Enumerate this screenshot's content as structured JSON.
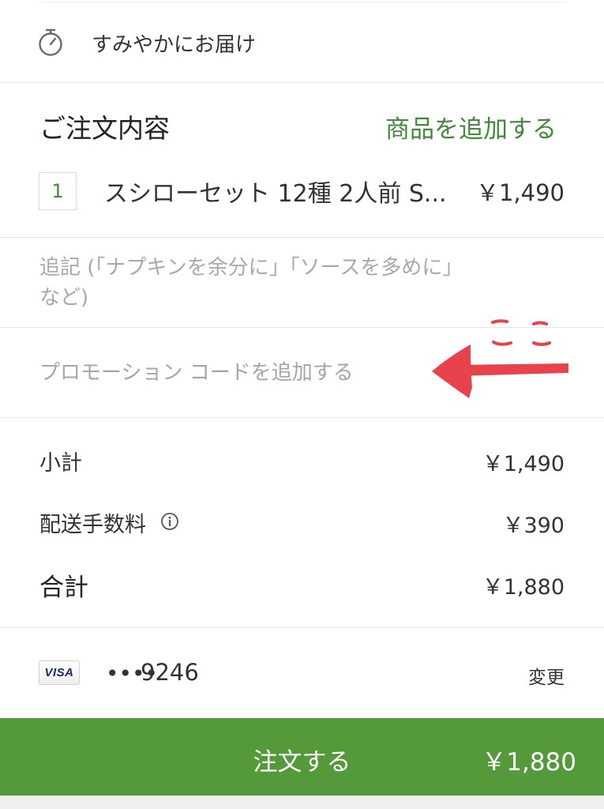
{
  "delivery": {
    "icon": "stopwatch-icon",
    "text": "すみやかにお届け"
  },
  "order": {
    "title": "ご注文内容",
    "add_items_label": "商品を追加する",
    "items": [
      {
        "quantity": "1",
        "name": "スシローセット 12種 2人前 S...",
        "price": "￥1,490"
      }
    ]
  },
  "notes": {
    "placeholder_line1": "追記 (「ナプキンを余分に」「ソースを多めに」",
    "placeholder_line2": "など)"
  },
  "promo": {
    "label": "プロモーション コードを追加する"
  },
  "annotation": {
    "text": "ここ",
    "color": "#e8424d"
  },
  "summary": {
    "subtotal_label": "小計",
    "subtotal_value": "￥1,490",
    "fee_label": "配送手数料",
    "fee_info_icon": "info-icon",
    "fee_value": "￥390",
    "total_label": "合計",
    "total_value": "￥1,880"
  },
  "payment": {
    "brand": "VISA",
    "masked_dots": "••••",
    "last4": "9246",
    "change_label": "変更"
  },
  "checkout": {
    "label": "注文する",
    "price": "￥1,880",
    "color": "#549a3a"
  },
  "colors": {
    "accent_green": "#43893a",
    "checkout_green": "#549a3a",
    "placeholder_gray": "#a9a9a9",
    "divider": "#e6e6e6"
  }
}
